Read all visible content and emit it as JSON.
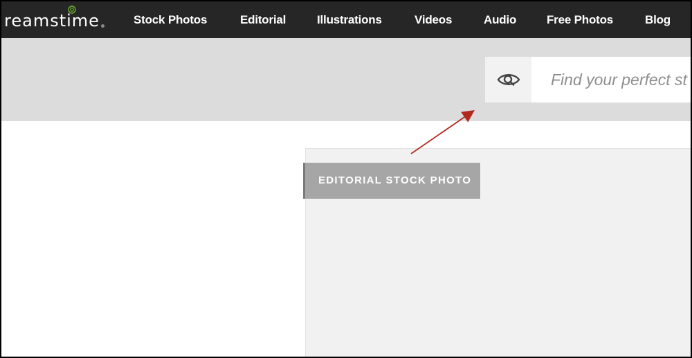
{
  "header": {
    "logo_text": "reamstime",
    "nav": [
      {
        "label": "Stock Photos"
      },
      {
        "label": "Editorial"
      },
      {
        "label": "Illustrations"
      },
      {
        "label": "Videos"
      },
      {
        "label": "Audio"
      },
      {
        "label": "Free Photos"
      },
      {
        "label": "Blog"
      }
    ]
  },
  "search": {
    "icon": "eye-search-icon",
    "placeholder": "Find your perfect st"
  },
  "main": {
    "badge_label": "EDITORIAL STOCK PHOTO"
  },
  "annotation": {
    "arrow_color": "#b22a1e"
  },
  "colors": {
    "topbar": "#262626",
    "search_band": "#dcdcdc",
    "badge_bg": "#a6a6a6",
    "logo_accent": "#6fb52c"
  }
}
